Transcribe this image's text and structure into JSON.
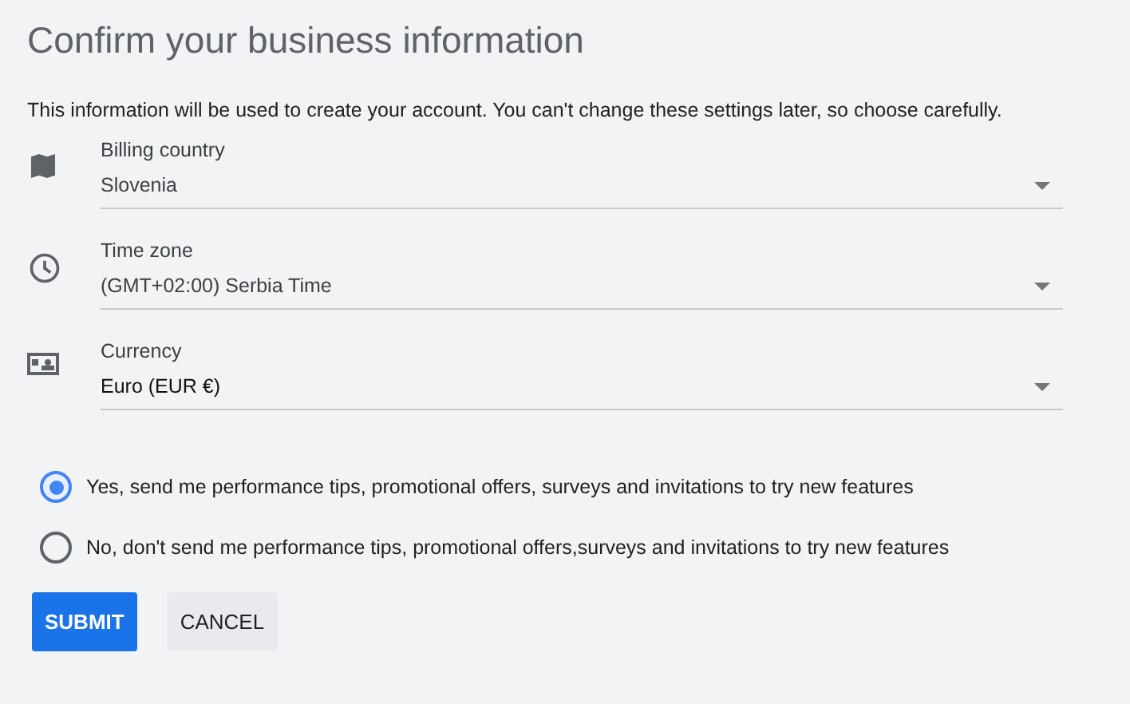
{
  "title": "Confirm your business information",
  "intro": "This information will be used to create your account. You can't change these settings later, so choose carefully.",
  "fields": [
    {
      "label": "Billing country",
      "value": "Slovenia"
    },
    {
      "label": "Time zone",
      "value": "(GMT+02:00) Serbia Time"
    },
    {
      "label": "Currency",
      "value": "Euro (EUR €)"
    }
  ],
  "options": [
    {
      "label": "Yes, send me performance tips, promotional offers, surveys and invitations to try new features",
      "selected": true
    },
    {
      "label": "No, don't send me performance tips, promotional offers,surveys and invitations to try new features",
      "selected": false
    }
  ],
  "buttons": [
    {
      "label": "SUBMIT",
      "kind": "primary"
    },
    {
      "label": "CANCEL",
      "kind": "secondary"
    }
  ]
}
